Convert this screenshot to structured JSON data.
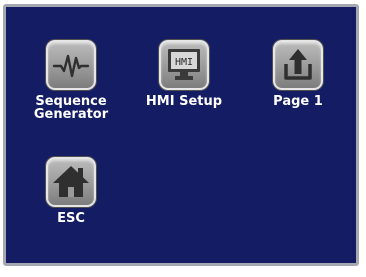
{
  "menu": {
    "items": [
      {
        "label": "Sequence\nGenerator",
        "icon": "waveform-icon"
      },
      {
        "label": "HMI Setup",
        "icon": "monitor-icon",
        "icon_text": "HMI"
      },
      {
        "label": "Page 1",
        "icon": "arrow-up-icon"
      },
      {
        "label": "ESC",
        "icon": "home-icon"
      }
    ]
  },
  "colors": {
    "screen_background": "#141c63",
    "label_text": "#ffffff",
    "button_face": "#9a9a9a",
    "icon_dark": "#2f2f2f"
  }
}
